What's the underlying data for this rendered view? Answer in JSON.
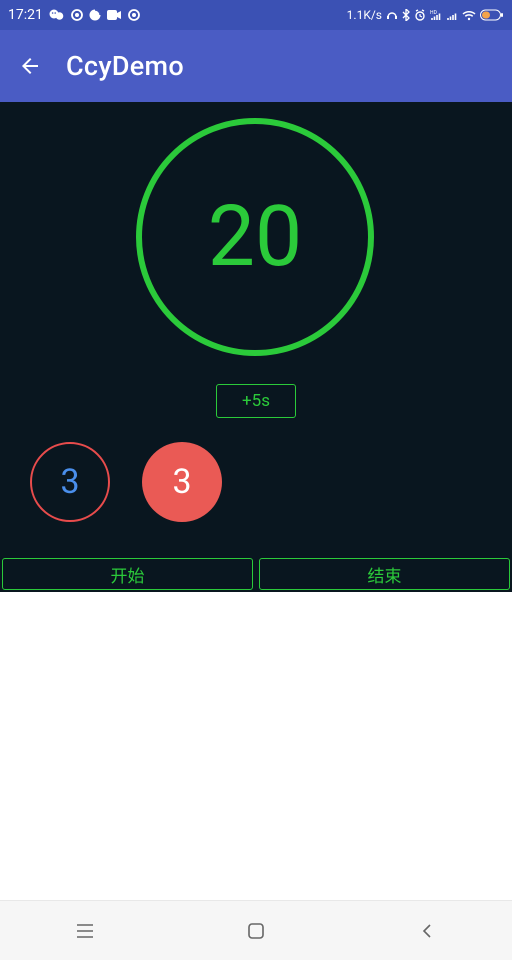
{
  "statusbar": {
    "time": "17:21",
    "net_speed": "1.1K/s"
  },
  "appbar": {
    "title": "CcyDemo"
  },
  "panel": {
    "big_number": "20",
    "plus_label": "+5s",
    "small1": "3",
    "small2": "3",
    "start_label": "开始",
    "end_label": "结束"
  }
}
